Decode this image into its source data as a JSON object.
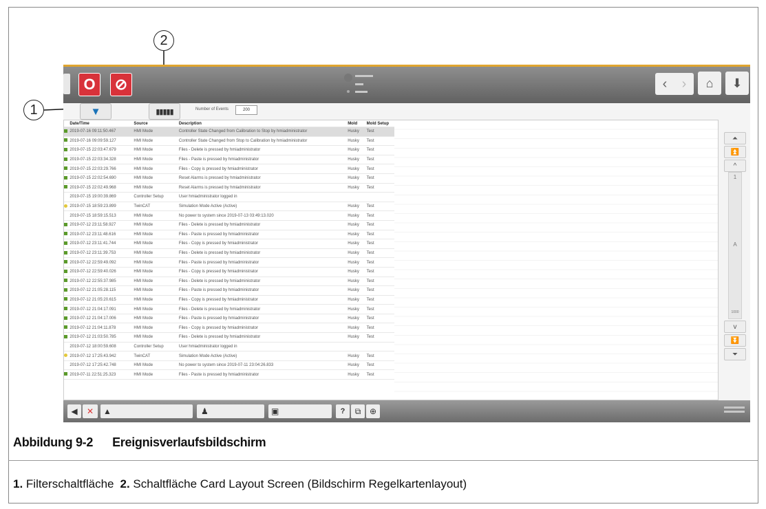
{
  "callouts": {
    "one": "1",
    "two": "2"
  },
  "toolbar": {
    "number_of_events_label": "Number of Events",
    "number_of_events_value": "200"
  },
  "table": {
    "headers": [
      "Date/Time",
      "Source",
      "Description",
      "Mold",
      "Mold Setup"
    ],
    "rows": [
      {
        "flag": "green",
        "datetime": "2019-07-16 09:11:50.467",
        "source": "HMI Mode",
        "description": "Controller State Changed from Calibration to Stop by hmiadministrator",
        "mold": "Husky",
        "setup": "Test",
        "selected": true
      },
      {
        "flag": "green",
        "datetime": "2019-07-16 09:09:59.127",
        "source": "HMI Mode",
        "description": "Controller State Changed from Stop to Calibration by hmiadministrator",
        "mold": "Husky",
        "setup": "Test"
      },
      {
        "flag": "green",
        "datetime": "2019-07-15 22:03:47.679",
        "source": "HMI Mode",
        "description": "Files - Delete is pressed by hmiadministrator",
        "mold": "Husky",
        "setup": "Test"
      },
      {
        "flag": "green",
        "datetime": "2019-07-15 22:03:34.328",
        "source": "HMI Mode",
        "description": "Files - Paste is pressed by hmiadministrator",
        "mold": "Husky",
        "setup": "Test"
      },
      {
        "flag": "green",
        "datetime": "2019-07-15 22:03:29.766",
        "source": "HMI Mode",
        "description": "Files - Copy is pressed by hmiadministrator",
        "mold": "Husky",
        "setup": "Test"
      },
      {
        "flag": "green",
        "datetime": "2019-07-15 22:02:54.690",
        "source": "HMI Mode",
        "description": "Reset Alarms is pressed by hmiadministrator",
        "mold": "Husky",
        "setup": "Test"
      },
      {
        "flag": "green",
        "datetime": "2019-07-15 22:02:49.968",
        "source": "HMI Mode",
        "description": "Reset Alarms is pressed by hmiadministrator",
        "mold": "Husky",
        "setup": "Test"
      },
      {
        "flag": "",
        "datetime": "2019-07-15 19:00:39.869",
        "source": "Controller Setup",
        "description": "User hmiadministrator logged in",
        "mold": "",
        "setup": ""
      },
      {
        "flag": "yellow",
        "datetime": "2019-07-15 18:59:23.899",
        "source": "TwinCAT",
        "description": "Simulation Mode Active (Active)",
        "mold": "Husky",
        "setup": "Test"
      },
      {
        "flag": "",
        "datetime": "2019-07-15 18:59:15.513",
        "source": "HMI Mode",
        "description": "No power to system since 2019-07-13 03:49:13.020",
        "mold": "Husky",
        "setup": "Test"
      },
      {
        "flag": "green",
        "datetime": "2019-07-12 23:11:58.927",
        "source": "HMI Mode",
        "description": "Files - Delete is pressed by hmiadministrator",
        "mold": "Husky",
        "setup": "Test"
      },
      {
        "flag": "green",
        "datetime": "2019-07-12 23:11:48.616",
        "source": "HMI Mode",
        "description": "Files - Paste is pressed by hmiadministrator",
        "mold": "Husky",
        "setup": "Test"
      },
      {
        "flag": "green",
        "datetime": "2019-07-12 23:11:41.744",
        "source": "HMI Mode",
        "description": "Files - Copy is pressed by hmiadministrator",
        "mold": "Husky",
        "setup": "Test"
      },
      {
        "flag": "green",
        "datetime": "2019-07-12 23:11:39.753",
        "source": "HMI Mode",
        "description": "Files - Delete is pressed by hmiadministrator",
        "mold": "Husky",
        "setup": "Test"
      },
      {
        "flag": "green",
        "datetime": "2019-07-12 22:59:49.092",
        "source": "HMI Mode",
        "description": "Files - Paste is pressed by hmiadministrator",
        "mold": "Husky",
        "setup": "Test"
      },
      {
        "flag": "green",
        "datetime": "2019-07-12 22:59:40.026",
        "source": "HMI Mode",
        "description": "Files - Copy is pressed by hmiadministrator",
        "mold": "Husky",
        "setup": "Test"
      },
      {
        "flag": "green",
        "datetime": "2019-07-12 22:55:37.985",
        "source": "HMI Mode",
        "description": "Files - Delete is pressed by hmiadministrator",
        "mold": "Husky",
        "setup": "Test"
      },
      {
        "flag": "green",
        "datetime": "2019-07-12 21:05:28.115",
        "source": "HMI Mode",
        "description": "Files - Paste is pressed by hmiadministrator",
        "mold": "Husky",
        "setup": "Test"
      },
      {
        "flag": "green",
        "datetime": "2019-07-12 21:05:20.615",
        "source": "HMI Mode",
        "description": "Files - Copy is pressed by hmiadministrator",
        "mold": "Husky",
        "setup": "Test"
      },
      {
        "flag": "green",
        "datetime": "2019-07-12 21:04:17.091",
        "source": "HMI Mode",
        "description": "Files - Delete is pressed by hmiadministrator",
        "mold": "Husky",
        "setup": "Test"
      },
      {
        "flag": "green",
        "datetime": "2019-07-12 21:04:17.006",
        "source": "HMI Mode",
        "description": "Files - Paste is pressed by hmiadministrator",
        "mold": "Husky",
        "setup": "Test"
      },
      {
        "flag": "green",
        "datetime": "2019-07-12 21:04:11.878",
        "source": "HMI Mode",
        "description": "Files - Copy is pressed by hmiadministrator",
        "mold": "Husky",
        "setup": "Test"
      },
      {
        "flag": "green",
        "datetime": "2019-07-12 21:03:50.785",
        "source": "HMI Mode",
        "description": "Files - Delete is pressed by hmiadministrator",
        "mold": "Husky",
        "setup": "Test"
      },
      {
        "flag": "",
        "datetime": "2019-07-12 18:00:59.608",
        "source": "Controller Setup",
        "description": "User hmiadministrator logged in",
        "mold": "",
        "setup": ""
      },
      {
        "flag": "yellow",
        "datetime": "2019-07-12 17:25:43.942",
        "source": "TwinCAT",
        "description": "Simulation Mode Active (Active)",
        "mold": "Husky",
        "setup": "Test"
      },
      {
        "flag": "",
        "datetime": "2019-07-12 17:25:42.748",
        "source": "HMI Mode",
        "description": "No power to system since 2019-07-11 23:04:26.833",
        "mold": "Husky",
        "setup": "Test"
      },
      {
        "flag": "green",
        "datetime": "2019-07-11 22:51:25.323",
        "source": "HMI Mode",
        "description": "Files - Paste is pressed by hmiadministrator",
        "mold": "Husky",
        "setup": "Test"
      }
    ]
  },
  "scroller": {
    "track_top_label": "1",
    "track_mid_label": "A",
    "track_bottom_label": "1000"
  },
  "bottombar": {
    "help_label": "?"
  },
  "caption": {
    "figure_number": "Abbildung 9-2",
    "figure_title": "Ereignisverlaufsbildschirm"
  },
  "legend": {
    "item1_num": "1.",
    "item1_text": "Filterschaltfläche",
    "item2_num": "2.",
    "item2_text": "Schaltfläche Card Layout Screen (Bildschirm Regelkartenlayout)"
  },
  "colors": {
    "accent_orange": "#e0a52e",
    "red_button": "#d8323a",
    "filter_blue": "#1a73b8"
  }
}
